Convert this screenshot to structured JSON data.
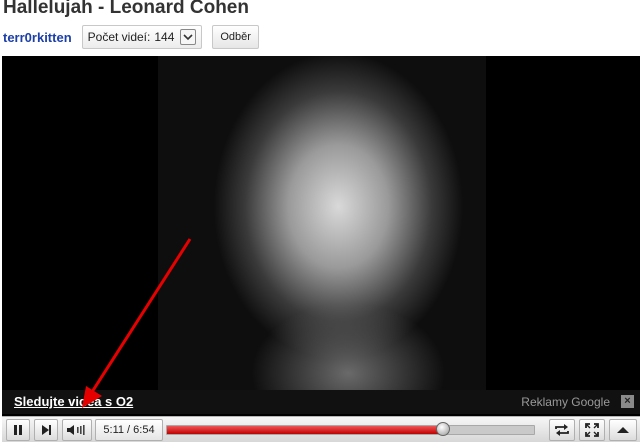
{
  "video": {
    "title": "Hallelujah - Leonard Cohen"
  },
  "channel": {
    "name": "terr0rkitten",
    "videos_label": "Počet videí:",
    "videos_count": "144",
    "subscribe_label": "Odběr"
  },
  "ad": {
    "link_text": "Sledujte videa s O2",
    "sponsor_text": "Reklamy Google",
    "close_glyph": "×"
  },
  "player": {
    "current_time": "5:11",
    "duration": "6:54",
    "time_display": "5:11 / 6:54",
    "progress_fraction": 0.751,
    "icons": [
      "pause-icon",
      "next-icon",
      "volume-icon",
      "loop-icon",
      "fullscreen-icon",
      "collapse-icon"
    ]
  },
  "colors": {
    "title": "#333333",
    "channel_link": "#1c3fa8",
    "progress_fill": "#c00000",
    "annotation_arrow": "#e60000"
  }
}
